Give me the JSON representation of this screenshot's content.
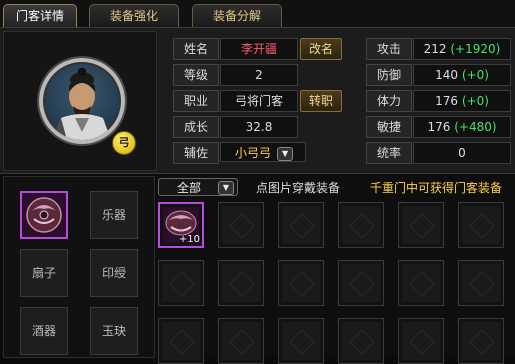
{
  "tabs": [
    {
      "label": "门客详情",
      "active": true
    },
    {
      "label": "装备强化",
      "active": false
    },
    {
      "label": "装备分解",
      "active": false
    }
  ],
  "portrait": {
    "badge": "弓"
  },
  "info": {
    "name_label": "姓名",
    "name_value": "李开疆",
    "rename_button": "改名",
    "level_label": "等级",
    "level_value": "2",
    "class_label": "职业",
    "class_value": "弓将门客",
    "change_class_button": "转职",
    "growth_label": "成长",
    "growth_value": "32.8",
    "assist_label": "辅佐",
    "assist_value": "小弓弓"
  },
  "stats": [
    {
      "label": "攻击",
      "base": "212",
      "bonus": "(+1920)"
    },
    {
      "label": "防御",
      "base": "140",
      "bonus": "(+0)"
    },
    {
      "label": "体力",
      "base": "176",
      "bonus": "(+0)"
    },
    {
      "label": "敏捷",
      "base": "176",
      "bonus": "(+480)"
    },
    {
      "label": "统率",
      "base": "0",
      "bonus": ""
    }
  ],
  "filter": {
    "selected": "全部"
  },
  "hint_text": "点图片穿戴装备",
  "hint_highlight": "千重门中可获得门客装备",
  "categories": [
    "乐器",
    "扇子",
    "印绶",
    "酒器",
    "玉玦"
  ],
  "bag_item": {
    "level": "+10"
  },
  "colors": {
    "accent_gold": "#e6c98a",
    "name_red": "#ff5b6b",
    "bonus_green": "#43e56a",
    "hint_yellow": "#ffd24a",
    "rarity_purple": "#b54cdb"
  }
}
